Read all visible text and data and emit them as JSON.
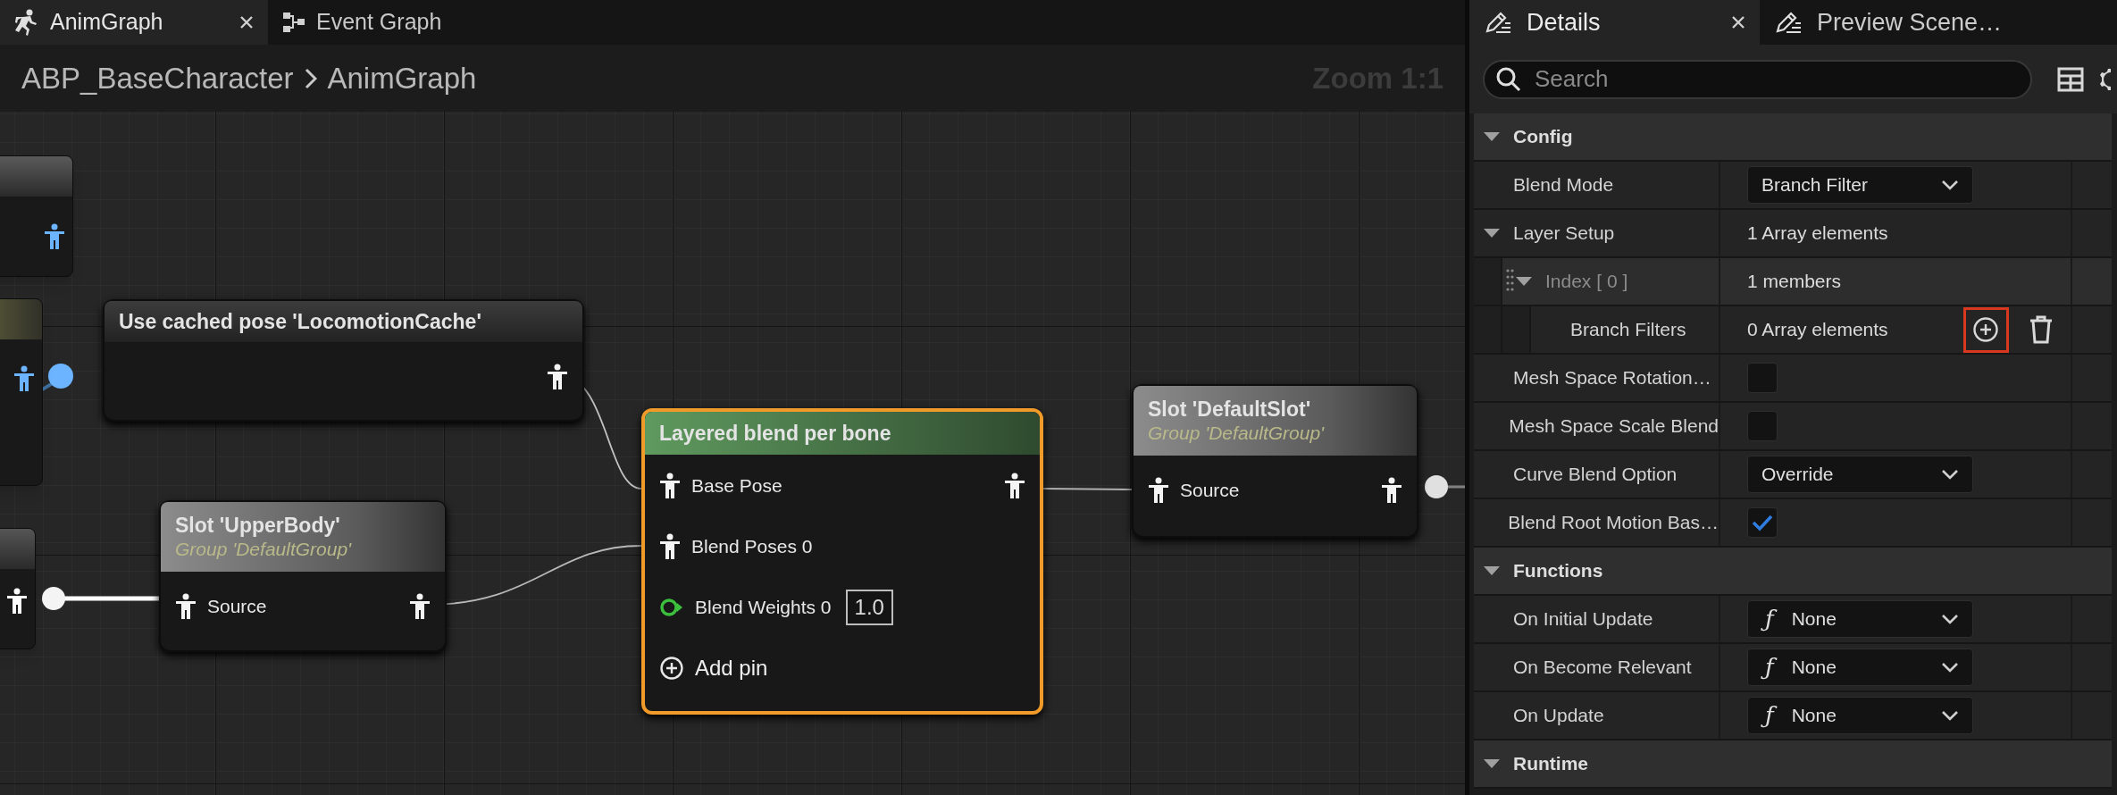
{
  "editor_tabs": [
    {
      "label": "AnimGraph",
      "selected": true,
      "closable": true
    },
    {
      "label": "Event Graph",
      "selected": false,
      "closable": false
    }
  ],
  "breadcrumb": [
    "ABP_BaseCharacter",
    "AnimGraph"
  ],
  "zoom_label": "Zoom 1:1",
  "nodes": [
    {
      "kind": "cached_pose",
      "title": "Use cached pose 'LocomotionCache'",
      "selected": false,
      "rows": [
        {
          "output": {
            "kind": "pose"
          }
        }
      ]
    },
    {
      "kind": "slot",
      "title": "Slot 'UpperBody'",
      "subtitle": "Group 'DefaultGroup'",
      "selected": false,
      "rows": [
        {
          "input": {
            "kind": "pose",
            "label": "Source"
          },
          "output": {
            "kind": "pose"
          }
        }
      ]
    },
    {
      "kind": "blend",
      "title": "Layered blend per bone",
      "selected": true,
      "rows": [
        {
          "input": {
            "kind": "pose",
            "label": "Base Pose"
          },
          "output": {
            "kind": "pose"
          }
        },
        {
          "input": {
            "kind": "pose",
            "label": "Blend Poses 0"
          }
        },
        {
          "input": {
            "kind": "float",
            "label": "Blend Weights 0",
            "value": "1.0"
          }
        },
        {
          "input": {
            "kind": "add",
            "label": "Add pin"
          }
        }
      ]
    },
    {
      "kind": "slot",
      "title": "Slot 'DefaultSlot'",
      "subtitle": "Group 'DefaultGroup'",
      "selected": false,
      "rows": [
        {
          "input": {
            "kind": "pose",
            "label": "Source"
          },
          "output": {
            "kind": "pose"
          }
        }
      ]
    }
  ],
  "details": {
    "tabs": [
      {
        "label": "Details",
        "selected": true,
        "closable": true
      },
      {
        "label": "Preview Scene…",
        "selected": false,
        "closable": false
      }
    ],
    "search": {
      "placeholder": "Search"
    },
    "sections": [
      {
        "label": "Config",
        "expanded": true,
        "properties": [
          {
            "kind": "dropdown",
            "label": "Blend Mode",
            "value": "Branch Filter"
          },
          {
            "kind": "text",
            "label": "Layer Setup",
            "value": "1 Array elements",
            "expanded": true,
            "children": [
              {
                "kind": "text",
                "label": "Index [ 0 ]",
                "value": "1 members",
                "expanded": true,
                "draggable": true,
                "children": [
                  {
                    "kind": "array",
                    "label": "Branch Filters",
                    "value": "0 Array elements",
                    "add_highlighted": true
                  }
                ]
              }
            ]
          },
          {
            "kind": "checkbox",
            "label": "Mesh Space Rotation…",
            "checked": false
          },
          {
            "kind": "checkbox",
            "label": "Mesh Space Scale Blend",
            "checked": false
          },
          {
            "kind": "dropdown",
            "label": "Curve Blend Option",
            "value": "Override"
          },
          {
            "kind": "checkbox",
            "label": "Blend Root Motion Bas…",
            "checked": true
          }
        ]
      },
      {
        "label": "Functions",
        "expanded": true,
        "properties": [
          {
            "kind": "function",
            "label": "On Initial Update",
            "prefix": "ƒ",
            "value": "None"
          },
          {
            "kind": "function",
            "label": "On Become Relevant",
            "prefix": "ƒ",
            "value": "None"
          },
          {
            "kind": "function",
            "label": "On Update",
            "prefix": "ƒ",
            "value": "None"
          }
        ]
      },
      {
        "label": "Runtime",
        "expanded": true
      }
    ]
  }
}
